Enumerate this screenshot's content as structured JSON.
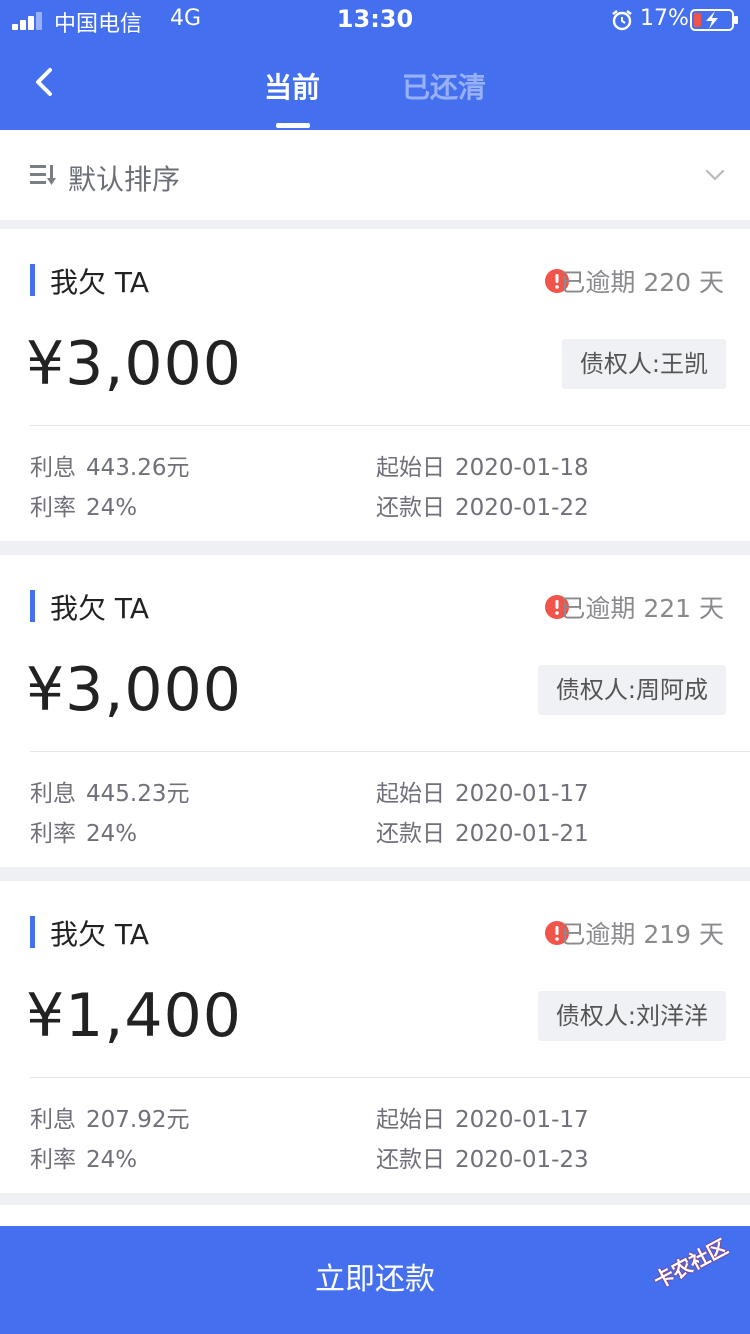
{
  "status_bar": {
    "carrier": "中国电信",
    "network": "4G",
    "time": "13:30",
    "battery": "17%",
    "icons": [
      "signal-icon",
      "alarm-icon",
      "battery-charging-icon"
    ]
  },
  "nav": {
    "back_icon": "chevron-left-icon",
    "tabs": [
      {
        "label": "当前",
        "active": true
      },
      {
        "label": "已还清",
        "active": false
      }
    ]
  },
  "sort": {
    "label": "默认排序",
    "icon": "sort-icon",
    "dropdown_icon": "chevron-down-icon"
  },
  "colors": {
    "accent": "#4470f0",
    "overdue_red": "#f0544a"
  },
  "loans": [
    {
      "title": "我欠 TA",
      "overdue": "已逾期 220 天",
      "amount": "¥3,000",
      "creditor": "债权人:王凯",
      "interest_label": "利息",
      "interest": "443.26元",
      "rate_label": "利率",
      "rate": "24%",
      "start_label": "起始日",
      "start": "2020-01-18",
      "due_label": "还款日",
      "due": "2020-01-22"
    },
    {
      "title": "我欠 TA",
      "overdue": "已逾期 221 天",
      "amount": "¥3,000",
      "creditor": "债权人:周阿成",
      "interest_label": "利息",
      "interest": "445.23元",
      "rate_label": "利率",
      "rate": "24%",
      "start_label": "起始日",
      "start": "2020-01-17",
      "due_label": "还款日",
      "due": "2020-01-21"
    },
    {
      "title": "我欠 TA",
      "overdue": "已逾期 219 天",
      "amount": "¥1,400",
      "creditor": "债权人:刘洋洋",
      "interest_label": "利息",
      "interest": "207.92元",
      "rate_label": "利率",
      "rate": "24%",
      "start_label": "起始日",
      "start": "2020-01-17",
      "due_label": "还款日",
      "due": "2020-01-23"
    }
  ],
  "pay_button": "立即还款",
  "watermark": "卡农社区"
}
